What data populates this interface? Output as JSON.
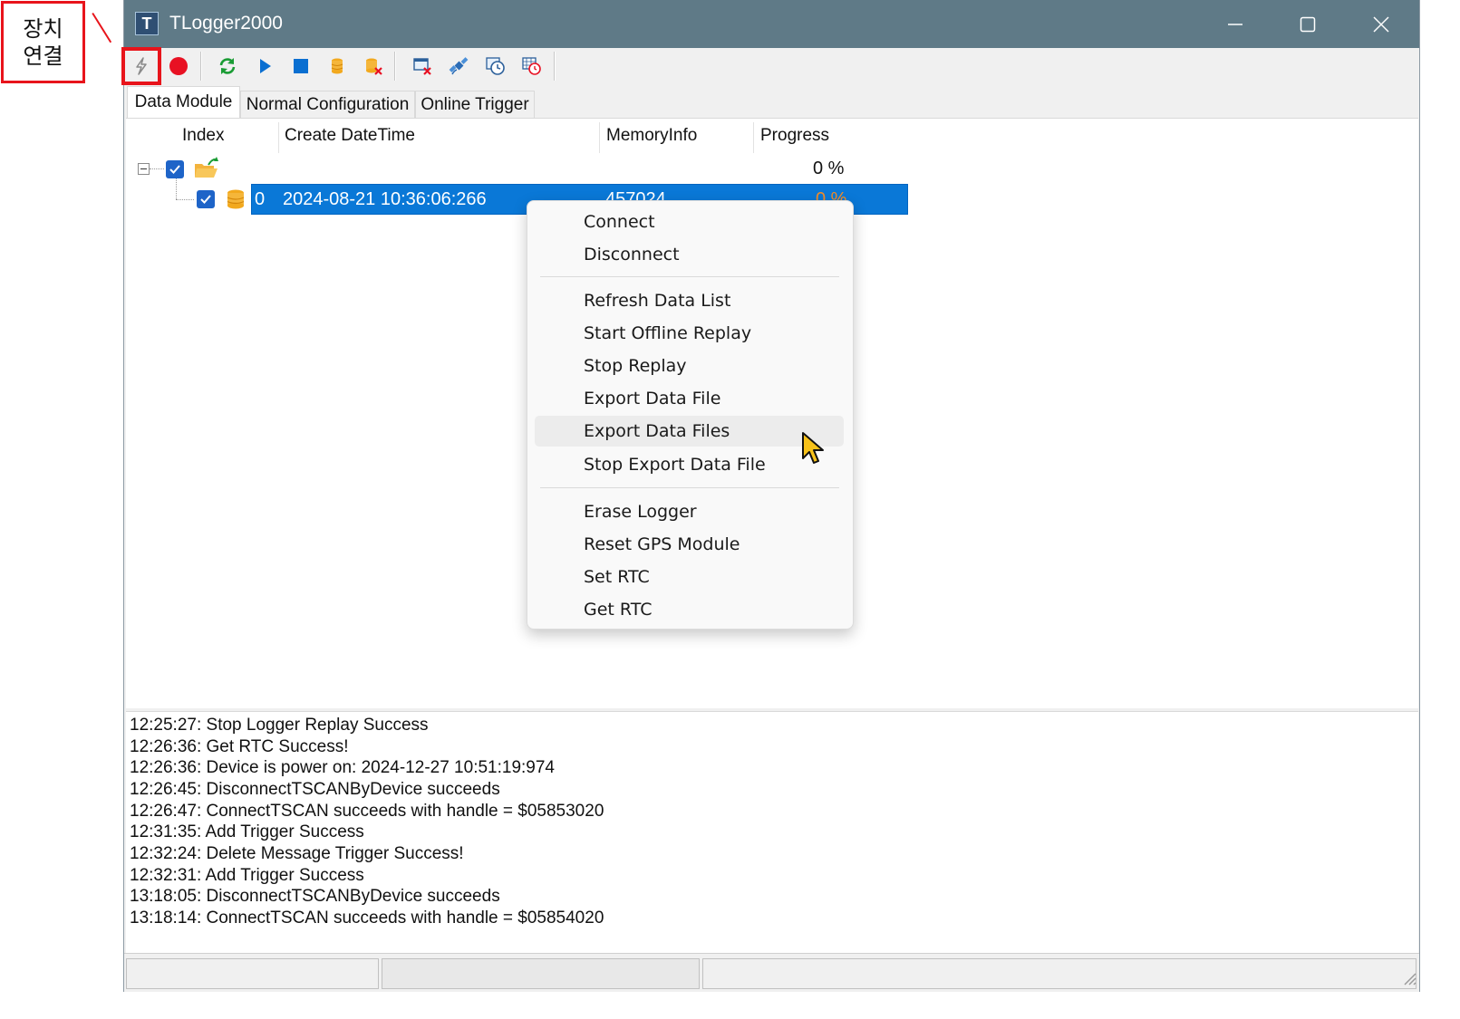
{
  "callout": {
    "line1": "장치",
    "line2": "연결"
  },
  "window": {
    "icon_letter": "T",
    "title": "TLogger2000"
  },
  "toolbar": {
    "buttons": [
      "connect-device",
      "record",
      "refresh-data-list",
      "start-offline-replay",
      "stop-replay",
      "export-data-file",
      "stop-export-data-file",
      "erase-logger",
      "reset-gps-module",
      "set-rtc",
      "get-rtc"
    ]
  },
  "tabs": [
    "Data Module",
    "Normal Configuration",
    "Online Trigger"
  ],
  "table": {
    "columns": [
      "Index",
      "Create DateTime",
      "MemoryInfo",
      "Progress"
    ],
    "root": {
      "progress": "0 %"
    },
    "rows": [
      {
        "index": "0",
        "datetime": "2024-08-21 10:36:06:266",
        "memory": "457024",
        "progress": "0 %"
      }
    ]
  },
  "context_menu": {
    "groups": [
      [
        "Connect",
        "Disconnect"
      ],
      [
        "Refresh Data List",
        "Start Offline Replay",
        "Stop Replay",
        "Export Data File",
        "Export Data Files",
        "Stop Export Data File"
      ],
      [
        "Erase Logger",
        "Reset GPS Module",
        "Set RTC",
        "Get RTC"
      ]
    ],
    "hovered": "Export Data Files"
  },
  "log": [
    "12:25:27: Stop Logger Replay Success",
    "12:26:36: Get RTC Success!",
    "12:26:36: Device is power on: 2024-12-27 10:51:19:974",
    "12:26:45: DisconnectTSCANByDevice succeeds",
    "12:26:47: ConnectTSCAN succeeds with handle = $05853020",
    "12:31:35: Add Trigger Success",
    "12:32:24: Delete Message Trigger Success!",
    "12:32:31: Add Trigger Success",
    "13:18:05: DisconnectTSCANByDevice succeeds",
    "13:18:14: ConnectTSCAN succeeds with handle = $05854020"
  ],
  "colors": {
    "titlebar": "#5f7a87",
    "selection": "#0a78d7",
    "highlight": "#e8141b",
    "record": "#e81123"
  }
}
